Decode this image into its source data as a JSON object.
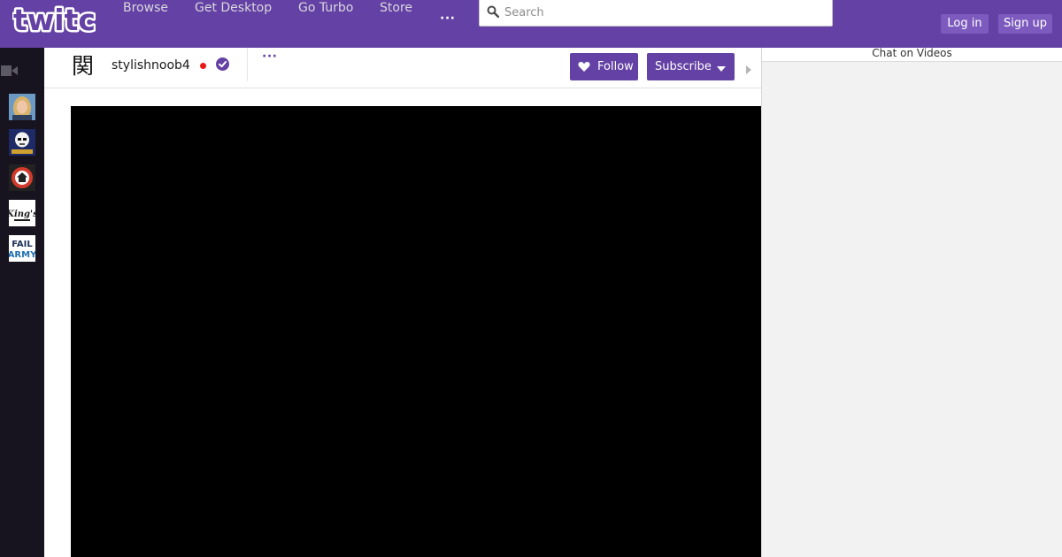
{
  "brand": {
    "logo_text": "twitch",
    "accent": "#6441a4",
    "sidebar_bg": "#17141f"
  },
  "nav": {
    "links": [
      "Browse",
      "Get Desktop",
      "Go Turbo",
      "Store"
    ],
    "more_label": "···"
  },
  "search": {
    "placeholder": "Search",
    "value": "",
    "icon": "search-icon"
  },
  "auth": {
    "login_label": "Log in",
    "signup_label": "Sign up"
  },
  "sidebar": {
    "header_icon": "camera-icon",
    "channels": [
      {
        "icon": "avatar-blonde-woman"
      },
      {
        "icon": "avatar-stormtrooper"
      },
      {
        "icon": "avatar-target-house"
      },
      {
        "icon": "avatar-kings"
      },
      {
        "icon": "avatar-failarmy",
        "line1": "FAIL",
        "line2": "ARMY"
      }
    ]
  },
  "channel": {
    "logo_glyph": "関",
    "name": "stylishnoob4",
    "live": true,
    "verified": true,
    "more_label": "···",
    "follow_label": "Follow",
    "subscribe_label": "Subscribe"
  },
  "chat": {
    "title": "Chat on Videos"
  }
}
